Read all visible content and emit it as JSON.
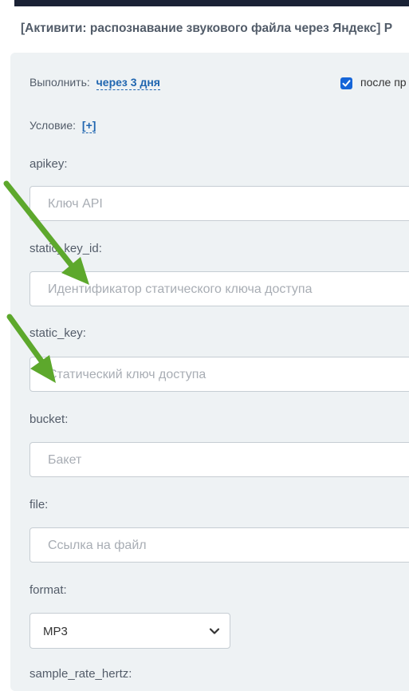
{
  "header": {
    "title": "[Активити: распознавание звукового файла через Яндекс] Р"
  },
  "execute": {
    "label": "Выполнить:",
    "value": "через 3 дня"
  },
  "after_checkbox": {
    "checked": true,
    "label": "после пр"
  },
  "condition": {
    "label": "Условие:",
    "add_label": "[+]"
  },
  "fields": [
    {
      "label": "apikey:",
      "placeholder": "Ключ API"
    },
    {
      "label": "static_key_id:",
      "placeholder": "Идентификатор статического ключа доступа"
    },
    {
      "label": "static_key:",
      "placeholder": "Статический ключ доступа"
    },
    {
      "label": "bucket:",
      "placeholder": "Бакет"
    },
    {
      "label": "file:",
      "placeholder": "Ссылка на файл"
    }
  ],
  "format": {
    "label": "format:",
    "value": "MP3"
  },
  "sample_rate": {
    "label": "sample_rate_hertz:"
  },
  "colors": {
    "accent": "#2066b0",
    "checkbox": "#1565d8",
    "arrow": "#5da82c",
    "panel": "#eef2f4"
  }
}
